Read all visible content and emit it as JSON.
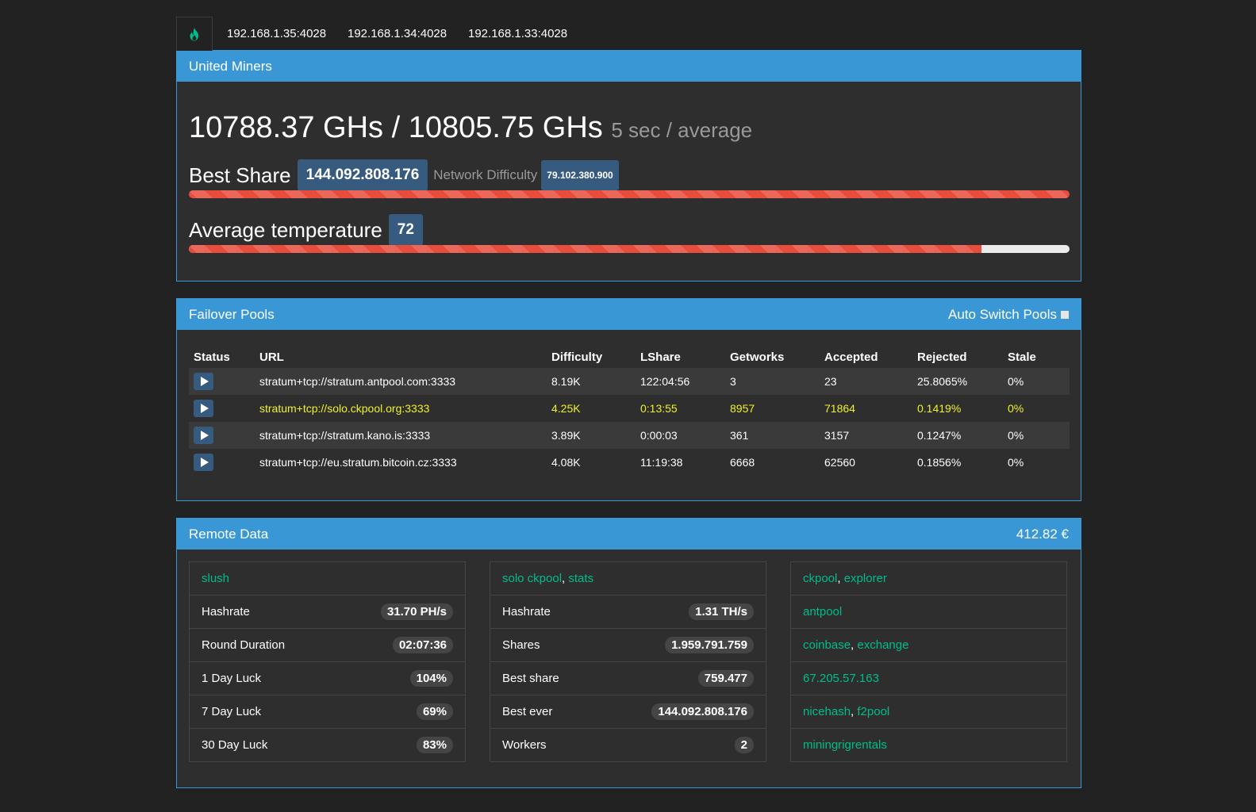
{
  "tabs": [
    "192.168.1.35:4028",
    "192.168.1.34:4028",
    "192.168.1.33:4028"
  ],
  "home_icon": "fire-icon",
  "accent_color": "#3a97d6",
  "summary": {
    "title": "United Miners",
    "hashrate": "10788.37 GHs / 10805.75 GHs",
    "hashrate_note": "5 sec / average",
    "best_share_label": "Best Share",
    "best_share": "144.092.808.176",
    "network_difficulty_label": "Network Difficulty",
    "network_difficulty": "79.102.380.900",
    "best_share_progress": 1.0,
    "avg_temp_label": "Average temperature",
    "avg_temp": "72",
    "avg_temp_progress": 0.9
  },
  "pools": {
    "title": "Failover Pools",
    "auto_switch": "Auto Switch Pools",
    "columns": [
      "Status",
      "URL",
      "Difficulty",
      "LShare",
      "Getworks",
      "Accepted",
      "Rejected",
      "Stale"
    ],
    "rows": [
      [
        "stratum+tcp://stratum.antpool.com:3333",
        "8.19K",
        "122:04:56",
        "3",
        "23",
        "25.8065%",
        "0%"
      ],
      [
        "stratum+tcp://solo.ckpool.org:3333",
        "4.25K",
        "0:13:55",
        "8957",
        "71864",
        "0.1419%",
        "0%"
      ],
      [
        "stratum+tcp://stratum.kano.is:3333",
        "3.89K",
        "0:00:03",
        "361",
        "3157",
        "0.1247%",
        "0%"
      ],
      [
        "stratum+tcp://eu.stratum.bitcoin.cz:3333",
        "4.08K",
        "11:19:38",
        "6668",
        "62560",
        "0.1856%",
        "0%"
      ]
    ],
    "active_row": 1
  },
  "remote": {
    "title": "Remote Data",
    "value": "412.82 €",
    "slush": {
      "header": "slush",
      "items": [
        {
          "label": "Hashrate",
          "value": "31.70 PH/s"
        },
        {
          "label": "Round Duration",
          "value": "02:07:36"
        },
        {
          "label": "1 Day Luck",
          "value": "104%"
        },
        {
          "label": "7 Day Luck",
          "value": "69%"
        },
        {
          "label": "30 Day Luck",
          "value": "83%"
        }
      ]
    },
    "ckpool": {
      "header_a": "solo ckpool",
      "header_b": "stats",
      "items": [
        {
          "label": "Hashrate",
          "value": "1.31 TH/s"
        },
        {
          "label": "Shares",
          "value": "1.959.791.759"
        },
        {
          "label": "Best share",
          "value": "759.477"
        },
        {
          "label": "Best ever",
          "value": "144.092.808.176"
        },
        {
          "label": "Workers",
          "value": "2"
        }
      ]
    },
    "links": [
      [
        "ckpool",
        "explorer"
      ],
      [
        "antpool"
      ],
      [
        "coinbase",
        "exchange"
      ],
      [
        "67.205.57.163"
      ],
      [
        "nicehash",
        "f2pool"
      ],
      [
        "miningrigrentals"
      ]
    ]
  }
}
